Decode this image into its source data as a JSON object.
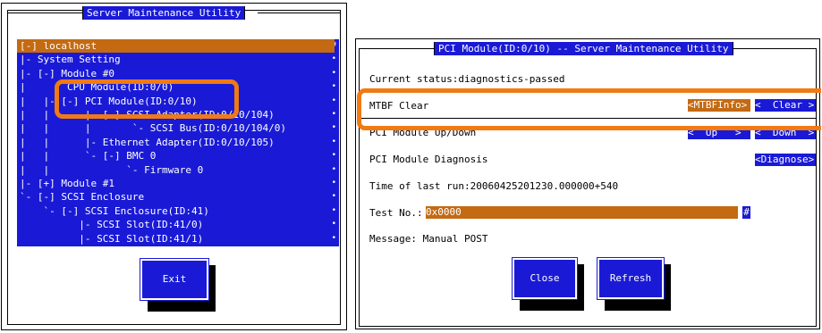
{
  "left": {
    "title": "Server Maintenance Utility",
    "tree": [
      {
        "text": "[-] localhost",
        "selected": true
      },
      {
        "text": "|- System Setting"
      },
      {
        "text": "|- [-] Module #0"
      },
      {
        "text": "|       CPU Module(ID:0/0)"
      },
      {
        "text": "|   |- [-] PCI Module(ID:0/10)"
      },
      {
        "text": "|   |      |- [-] SCSI Adapter(ID:0/10/104)"
      },
      {
        "text": "|   |      |       `- SCSI Bus(ID:0/10/104/0)"
      },
      {
        "text": "|   |      |- Ethernet Adapter(ID:0/10/105)"
      },
      {
        "text": "|   |      `- [-] BMC 0"
      },
      {
        "text": "|   |             `- Firmware 0"
      },
      {
        "text": "|- [+] Module #1"
      },
      {
        "text": "`- [-] SCSI Enclosure"
      },
      {
        "text": "    `- [-] SCSI Enclosure(ID:41)"
      },
      {
        "text": "          |- SCSI Slot(ID:41/0)"
      },
      {
        "text": "          |- SCSI Slot(ID:41/1)"
      }
    ],
    "scroll_top": "#",
    "exit_label": "Exit"
  },
  "right": {
    "title": "PCI Module(ID:0/10) -- Server Maintenance Utility",
    "status": "Current status:diagnostics-passed",
    "mtbf_label": "MTBF Clear",
    "mtbf_info": "<MTBFInfo>",
    "mtbf_clear": "<  Clear >",
    "updown_label": "PCI Module Up/Down",
    "up": "<  Up   >",
    "down": "<  Down  >",
    "diag_label": "PCI Module Diagnosis",
    "diagnose": "<Diagnose>",
    "time_label": "Time of last run:20060425201230.000000+540",
    "test_label": "Test No.:",
    "test_value": "0x0000",
    "test_end": "#",
    "message": "Message: Manual POST",
    "close_label": "Close",
    "refresh_label": "Refresh"
  },
  "colors": {
    "blue": "#1a1ad6",
    "orange_select": "#c46a12",
    "highlight": "#f07a14"
  }
}
